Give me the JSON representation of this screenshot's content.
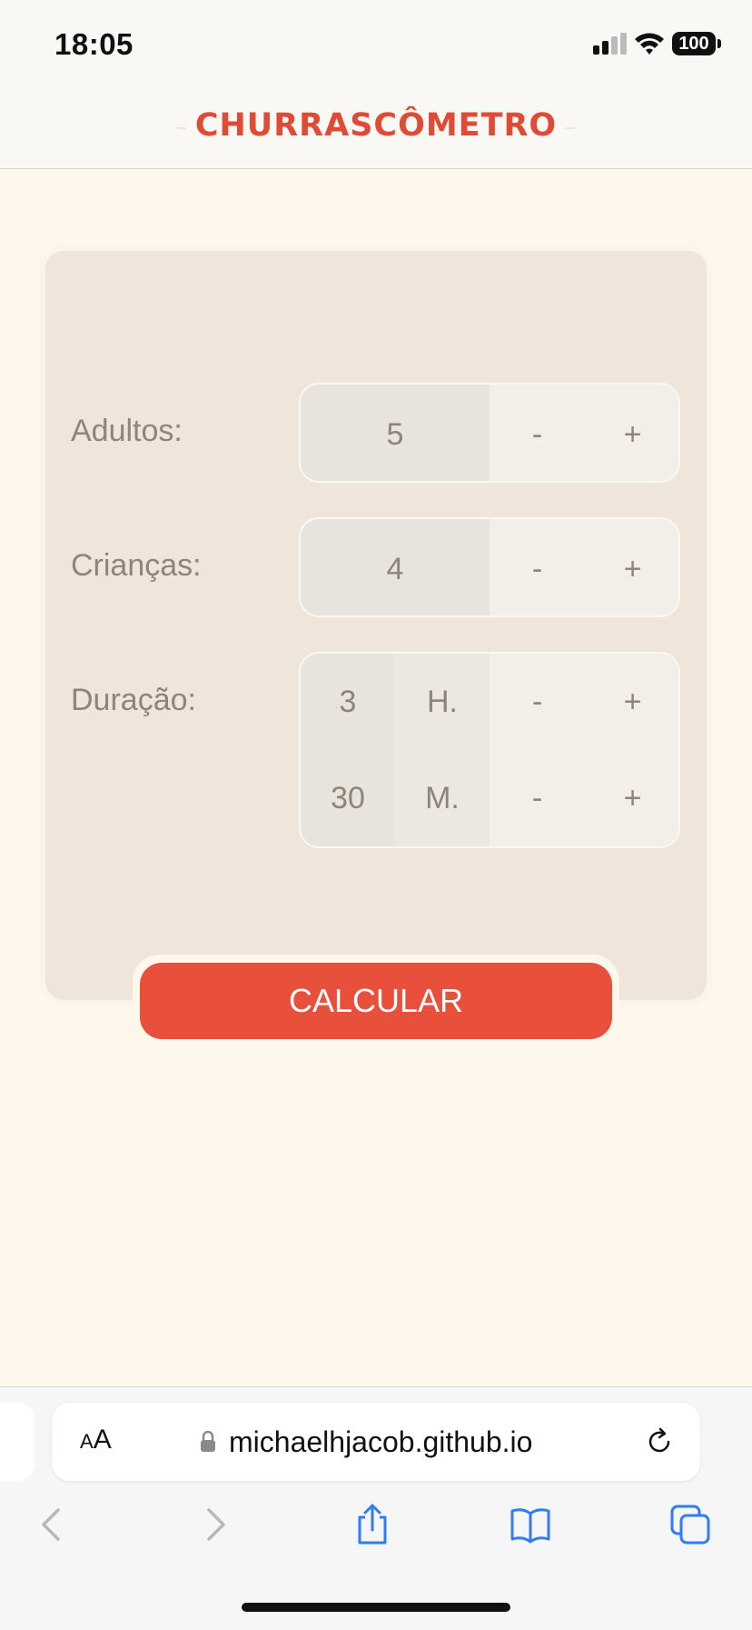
{
  "status_bar": {
    "time": "18:05",
    "battery": "100"
  },
  "header": {
    "title": "CHURRASCÔMETRO"
  },
  "form": {
    "adults": {
      "label": "Adultos:",
      "value": "5",
      "minus": "-",
      "plus": "+"
    },
    "children": {
      "label": "Crianças:",
      "value": "4",
      "minus": "-",
      "plus": "+"
    },
    "duration": {
      "label": "Duração:",
      "hours": {
        "value": "3",
        "unit": "H.",
        "minus": "-",
        "plus": "+"
      },
      "minutes": {
        "value": "30",
        "unit": "M.",
        "minus": "-",
        "plus": "+"
      }
    },
    "calculate_label": "CALCULAR"
  },
  "browser": {
    "aa_small": "A",
    "aa_large": "A",
    "url": "michaelhjacob.github.io",
    "icons": [
      "lock-icon",
      "reload-icon",
      "back-icon",
      "forward-icon",
      "share-icon",
      "bookmarks-icon",
      "tabs-icon"
    ]
  },
  "colors": {
    "accent": "#e8503c",
    "title": "#e04b36",
    "card": "#f0e5db",
    "background": "#fdf7ec"
  }
}
